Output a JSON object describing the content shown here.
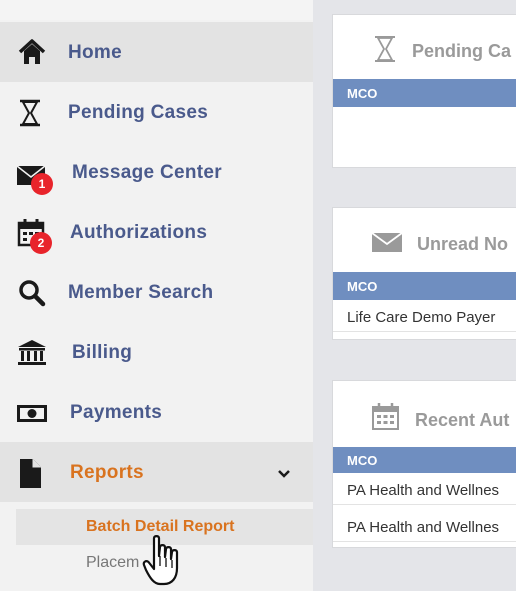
{
  "sidebar": {
    "items": [
      {
        "label": "Home"
      },
      {
        "label": "Pending Cases"
      },
      {
        "label": "Message Center",
        "badge": "1"
      },
      {
        "label": "Authorizations",
        "badge": "2"
      },
      {
        "label": "Member Search"
      },
      {
        "label": "Billing"
      },
      {
        "label": "Payments"
      },
      {
        "label": "Reports"
      }
    ],
    "reports_submenu": [
      {
        "label": "Batch Detail Report"
      },
      {
        "label": "Placem"
      }
    ]
  },
  "cards": {
    "pending": {
      "title": "Pending Ca",
      "column": "MCO"
    },
    "unread": {
      "title": "Unread No",
      "column": "MCO",
      "rows": [
        "Life Care Demo Payer"
      ]
    },
    "recent": {
      "title": "Recent Aut",
      "column": "MCO",
      "rows": [
        "PA Health and Wellnes",
        "PA Health and Wellnes"
      ]
    }
  },
  "colors": {
    "nav_text": "#4a5a8c",
    "active_orange": "#d9731f",
    "table_header": "#6f8ec0",
    "badge_red": "#e8242b"
  }
}
